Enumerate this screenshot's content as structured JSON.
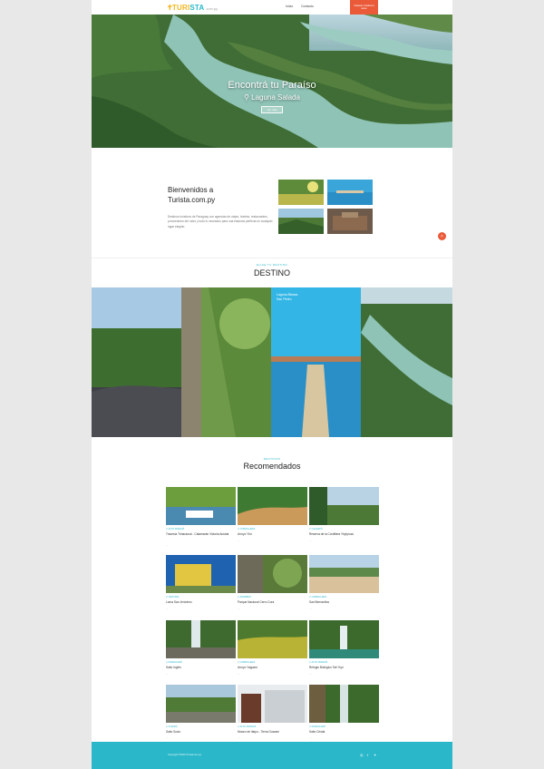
{
  "nav": {
    "logo_part1": "TURI",
    "logo_part2": "STA",
    "logo_suffix": ".com.py",
    "links": [
      "Inicio",
      "Contacto"
    ],
    "cta_label": "Visitaste, Publicá tu aviso"
  },
  "hero": {
    "title": "Encontrá tu Paraíso",
    "location": "Laguna Salada",
    "button_label": "Ver más"
  },
  "welcome": {
    "title_line1": "Bienvenidos a",
    "title_line2": "Turista.com.py",
    "text": "Destinos turísticos de Paraguay con agencias de viajes, hoteles, restaurantes, proveedores del rubro y todo lo necesario para una estancia perfecta en cualquier lugar elegido."
  },
  "destino": {
    "eyebrow": "ELIGE TU DESTINO",
    "title": "DESTINO",
    "panels": [
      {
        "label": ""
      },
      {
        "label": ""
      },
      {
        "label": "Laguna Blanca",
        "sublabel": "San Pedro"
      },
      {
        "label": ""
      }
    ]
  },
  "recommended": {
    "eyebrow": "DESTINOS",
    "title": "Recomendados",
    "cards": [
      {
        "category": "ALTO PARANÁ",
        "title": "Travesía Trinacional - Catamarán Victoria Austral",
        "dots": "..."
      },
      {
        "category": "CORDILLERA",
        "title": "Arroyo Yhú",
        "dots": "..."
      },
      {
        "category": "CAAZAPÁ",
        "title": "Reserva de la Cordillera Ybytyruzú",
        "dots": "..."
      },
      {
        "category": "CENTRAL",
        "title": "Loma San Jerónimo",
        "dots": "..."
      },
      {
        "category": "AMAMBAY",
        "title": "Parque Nacional Cerro Corá",
        "dots": "..."
      },
      {
        "category": "CORDILLERA",
        "title": "San Bernardino",
        "dots": "..."
      },
      {
        "category": "PARAGUARÍ",
        "title": "Salto Inglés",
        "dots": "..."
      },
      {
        "category": "CORDILLERA",
        "title": "Arroyo Yaguarú",
        "dots": "..."
      },
      {
        "category": "ALTO PARANÁ",
        "title": "Refugio Biológico Tatí Yupí",
        "dots": "..."
      },
      {
        "category": "GUAIRÁ",
        "title": "Salto Suizo",
        "dots": "..."
      },
      {
        "category": "ALTO PARANÁ",
        "title": "Museo de Itaipu - Tierra Guaraní",
        "dots": "..."
      },
      {
        "category": "PARAGUARÍ",
        "title": "Salto Cristal",
        "dots": "..."
      }
    ]
  },
  "footer": {
    "copyright": "Copyright ©2024 Turista.com.py"
  },
  "colors": {
    "accent": "#2ab7c9",
    "cta": "#ea5a38",
    "logo_yellow": "#f2b51c"
  }
}
